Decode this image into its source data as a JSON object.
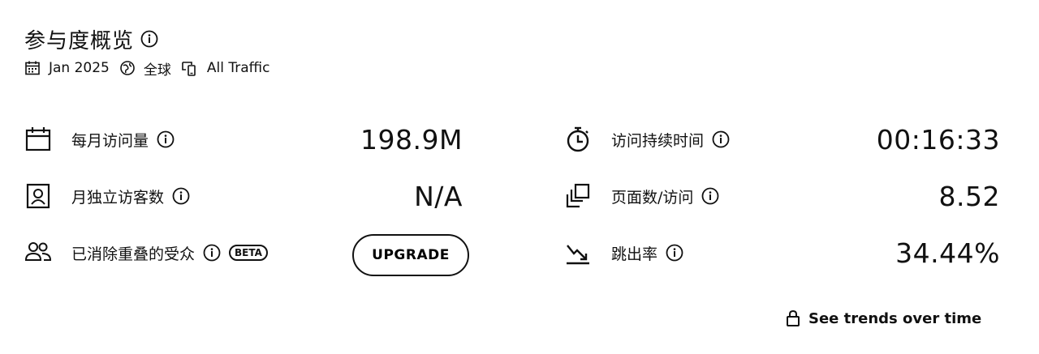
{
  "header": {
    "title": "参与度概览",
    "filters": {
      "date": "Jan 2025",
      "region": "全球",
      "traffic": "All Traffic"
    }
  },
  "metrics": {
    "monthly_visits": {
      "label": "每月访问量",
      "value": "198.9M",
      "icon": "calendar-icon"
    },
    "unique_visitors": {
      "label": "月独立访客数",
      "value": "N/A",
      "icon": "user-card-icon"
    },
    "dedup_audience": {
      "label": "已消除重叠的受众",
      "badge": "BETA",
      "button": "UPGRADE",
      "icon": "people-icon"
    },
    "visit_duration": {
      "label": "访问持续时间",
      "value": "00:16:33",
      "icon": "stopwatch-icon"
    },
    "pages_per_visit": {
      "label": "页面数/访问",
      "value": "8.52",
      "icon": "stacked-pages-icon"
    },
    "bounce_rate": {
      "label": "跳出率",
      "value": "34.44%",
      "icon": "bounce-arrow-icon"
    }
  },
  "footer": {
    "trends_link": "See trends over time"
  }
}
